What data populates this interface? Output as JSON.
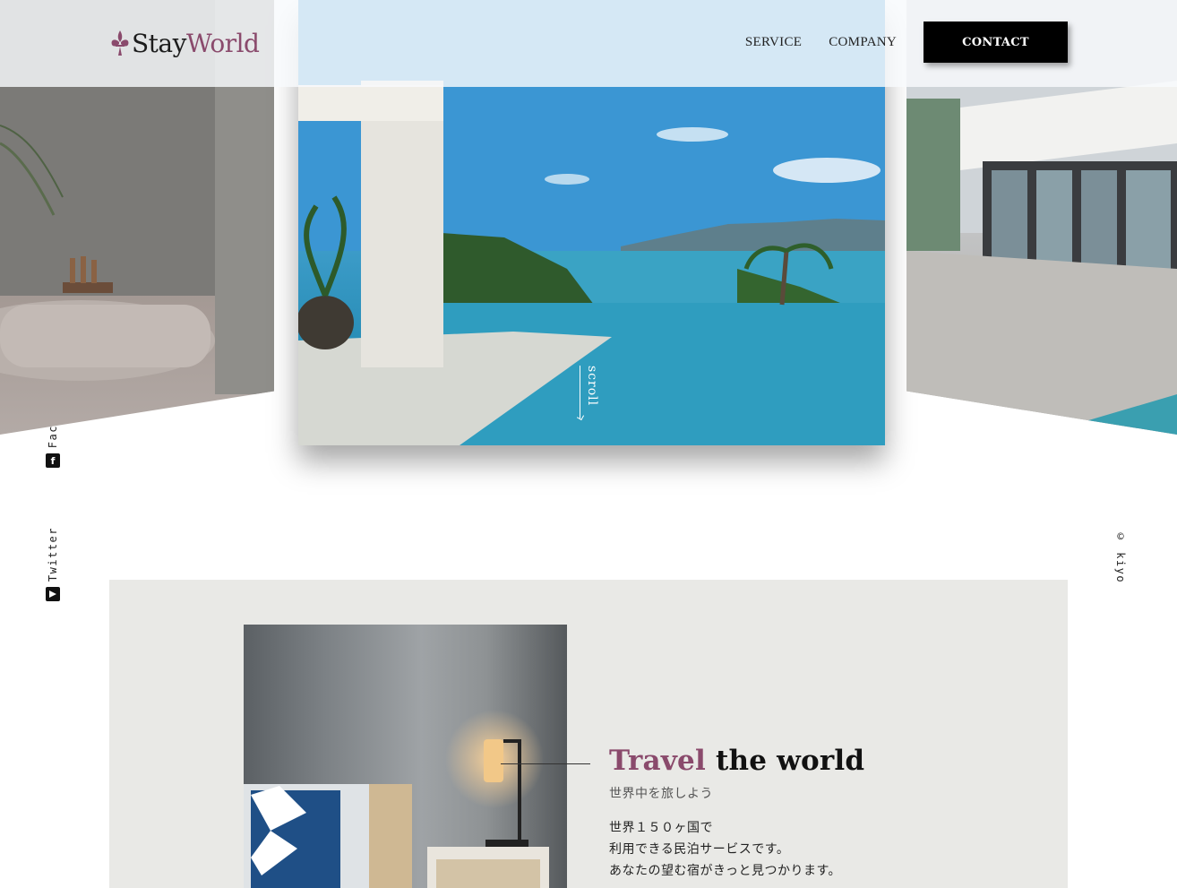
{
  "header": {
    "logo": {
      "stay": "Stay",
      "world": "World",
      "icon": "fleur-de-lis-icon"
    },
    "nav": [
      {
        "label": "SERVICE"
      },
      {
        "label": "COMPANY"
      }
    ],
    "contact_label": "CONTACT"
  },
  "hero": {
    "scroll_label": "scroll",
    "slides": [
      "bathroom",
      "infinity-pool",
      "modern-villa"
    ]
  },
  "social": {
    "facebook": {
      "label": "Fac",
      "icon": "facebook-icon"
    },
    "twitter": {
      "label": "Twitter",
      "icon": "twitter-icon"
    }
  },
  "copyright": "© kiyo",
  "about": {
    "heading_accent": "Travel",
    "heading_rest": " the world",
    "subheading": "世界中を旅しよう",
    "body": [
      "世界１５０ヶ国で",
      "利用できる民泊サービスです。",
      "あなたの望む宿がきっと見つかります。"
    ]
  },
  "colors": {
    "accent": "#8a4a6c",
    "contact_bg": "#000000",
    "section_bg": "#e9e9e6"
  }
}
